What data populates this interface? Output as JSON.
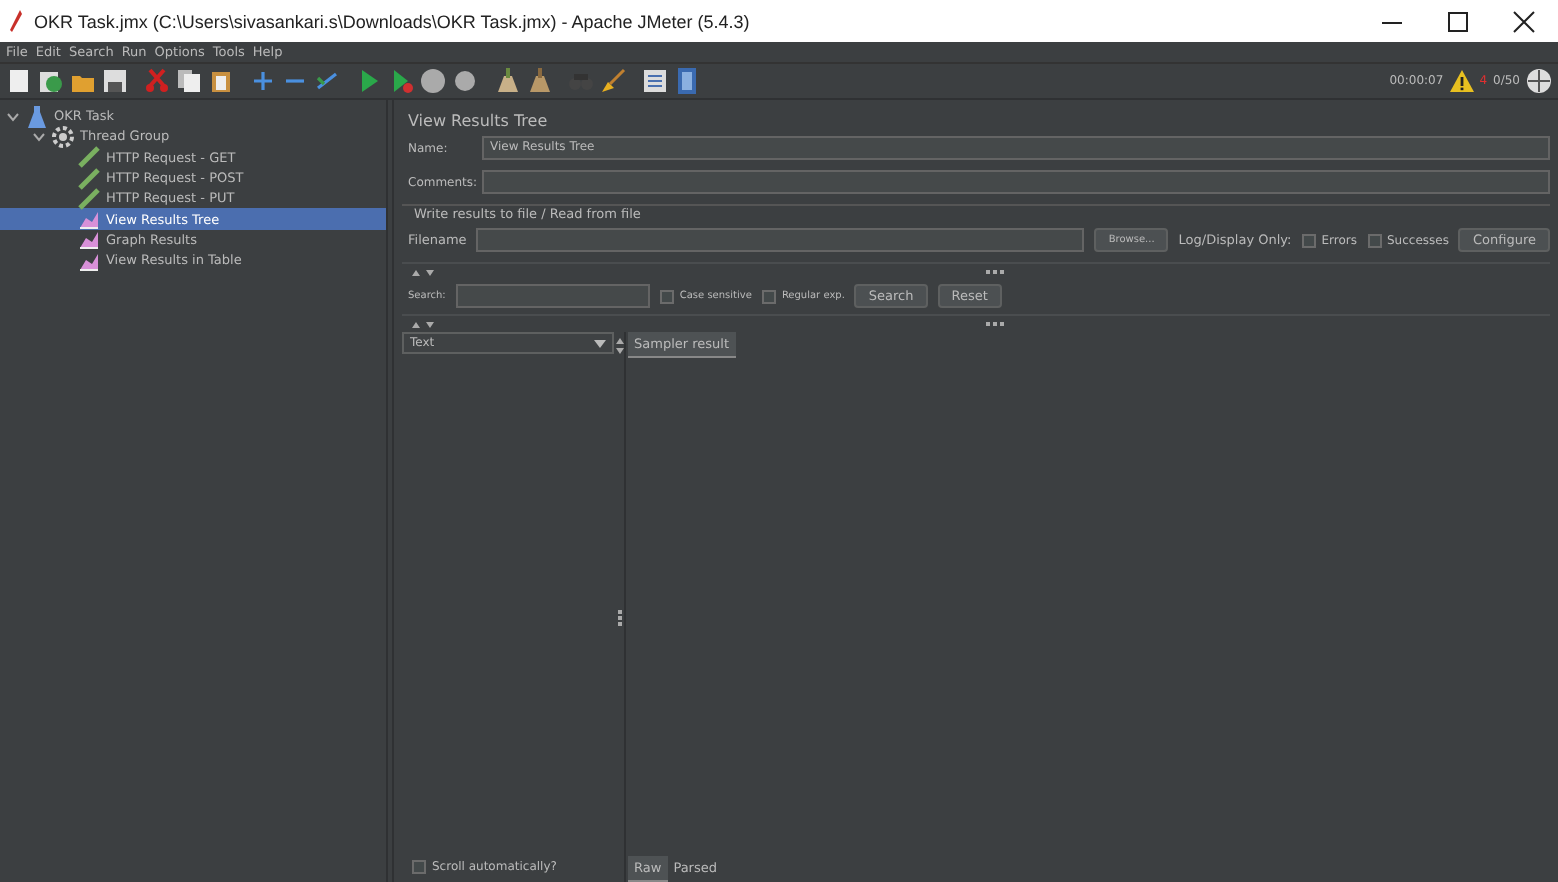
{
  "window": {
    "title": "OKR Task.jmx (C:\\Users\\sivasankari.s\\Downloads\\OKR Task.jmx) - Apache JMeter (5.4.3)"
  },
  "menu": [
    "File",
    "Edit",
    "Search",
    "Run",
    "Options",
    "Tools",
    "Help"
  ],
  "status": {
    "timer": "00:00:07",
    "warnings": "4",
    "threads": "0/50"
  },
  "tree": [
    {
      "label": "OKR Task",
      "kind": "plan",
      "expanded": true,
      "selected": false,
      "children": [
        {
          "label": "Thread Group",
          "kind": "threads",
          "expanded": true,
          "selected": false,
          "children": [
            {
              "label": "HTTP Request - GET",
              "kind": "sampler",
              "selected": false
            },
            {
              "label": "HTTP Request - POST",
              "kind": "sampler",
              "selected": false
            },
            {
              "label": "HTTP Request - PUT",
              "kind": "sampler",
              "selected": false
            },
            {
              "label": "View Results Tree",
              "kind": "listener",
              "selected": true
            },
            {
              "label": "Graph Results",
              "kind": "listener",
              "selected": false
            },
            {
              "label": "View Results in Table",
              "kind": "listener",
              "selected": false
            }
          ]
        }
      ]
    }
  ],
  "panel": {
    "title": "View Results Tree",
    "name_label": "Name:",
    "name_value": "View Results Tree",
    "comments_label": "Comments:",
    "file_group": "Write results to file / Read from file",
    "filename_label": "Filename",
    "browse": "Browse...",
    "log_label": "Log/Display Only:",
    "log_options": [
      {
        "label": "Errors",
        "checked": false
      },
      {
        "label": "Successes",
        "checked": false
      }
    ],
    "configure": "Configure",
    "search_label": "Search:",
    "search_options": [
      {
        "label": "Case sensitive",
        "checked": false
      },
      {
        "label": "Regular exp.",
        "checked": false
      }
    ],
    "search_button": "Search",
    "reset_button": "Reset",
    "renderer": "Text",
    "result_tabs": [
      {
        "label": "Sampler result",
        "selected": true
      }
    ],
    "scroll": {
      "label": "Scroll automatically?",
      "checked": false
    },
    "view_tabs": [
      {
        "label": "Raw",
        "selected": true
      },
      {
        "label": "Parsed",
        "selected": false
      }
    ]
  }
}
